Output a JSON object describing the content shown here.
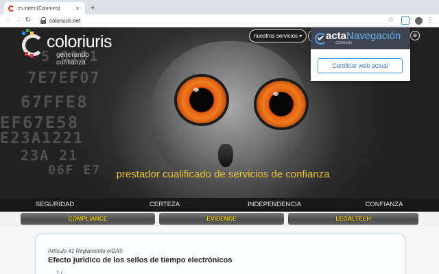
{
  "browser": {
    "tab_title": "es.index [Coloriuris]",
    "tab_close": "×",
    "new_tab": "+",
    "back": "←",
    "forward": "→",
    "reload": "↻",
    "url": "coloriuris.net",
    "star": "☆",
    "menu": "⋮"
  },
  "site": {
    "logo_text": "coloriuris",
    "logo_tagline": "generando confianza",
    "services_label": "nuestros servicios ▾",
    "globe": "⊕",
    "tagline": "prestador cualificado de servicios de confianza",
    "hex_lines": [
      "5 0181",
      "7E7EF07",
      "67FFE8",
      "EF67E58",
      "E23A1221",
      "23A 21",
      "06F E7"
    ]
  },
  "popup": {
    "brand_acta": "acta",
    "brand_nav": "Navegación",
    "brand_sub": "coloriuris",
    "certify_label": "Certificar web actual"
  },
  "nav": {
    "items": [
      "SEGURIDAD",
      "CERTEZA",
      "INDEPENDENCIA",
      "CONFIANZA"
    ]
  },
  "pills": {
    "items": [
      "COMPLIANCE",
      "EVIDENCE",
      "LEGALTECH"
    ]
  },
  "article": {
    "ref": "Artículo 41 Reglamento eIDAS",
    "title": "Efecto jurídico de los sellos de tiempo electrónicos",
    "more": "1  /"
  },
  "colors": {
    "accent_gold": "#e8c33a",
    "pill_text": "#f0d000",
    "popup_header": "#3e4551",
    "button_blue": "#3a7bd0"
  }
}
